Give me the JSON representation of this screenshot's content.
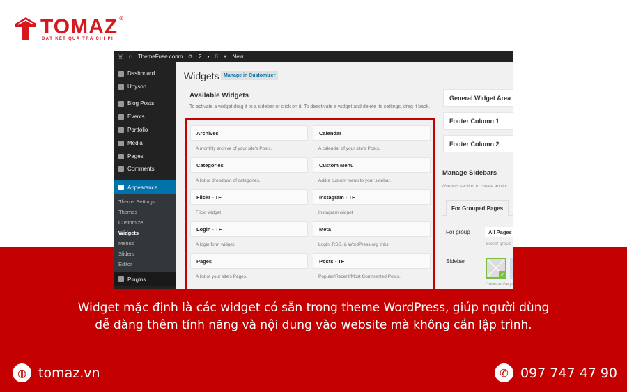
{
  "brand": {
    "name": "TOMAZ",
    "registered": "®",
    "tagline": "ĐẠT KẾT QUẢ TRẢ CHI PHÍ"
  },
  "colors": {
    "brand_red": "#c40000",
    "wp_accent": "#0073aa",
    "wp_dark": "#222222"
  },
  "wp": {
    "topbar": {
      "site": "ThemeFuse.conm",
      "updates": "2",
      "comments": "0",
      "new": "New"
    },
    "menu": [
      "Dashboard",
      "Unyson",
      "Blog Posts",
      "Events",
      "Portfolio",
      "Media",
      "Pages",
      "Comments"
    ],
    "appearance": "Appearance",
    "submenu": [
      "Theme Settings",
      "Themes",
      "Customize",
      "Widgets",
      "Menus",
      "Sliders",
      "Editor"
    ],
    "plugins": "Plugins",
    "title": "Widgets",
    "manage_customizer": "Manage in Customizer",
    "available_title": "Available Widgets",
    "available_desc": "To activate a widget drag it to a sidebar or click on it. To deactivate a widget and delete its settings, drag it back.",
    "widgets": [
      {
        "name": "Archives",
        "desc": "A monthly archive of your site's Posts."
      },
      {
        "name": "Calendar",
        "desc": "A calendar of your site's Posts."
      },
      {
        "name": "Categories",
        "desc": "A list or dropdown of categories."
      },
      {
        "name": "Custom Menu",
        "desc": "Add a custom menu to your sidebar."
      },
      {
        "name": "Flickr - TF",
        "desc": "Flickr widget"
      },
      {
        "name": "Instagram - TF",
        "desc": "Instagram widget"
      },
      {
        "name": "Login - TF",
        "desc": "A login form widget."
      },
      {
        "name": "Meta",
        "desc": "Login, RSS, & WordPress.org links."
      },
      {
        "name": "Pages",
        "desc": "A list of your site's Pages."
      },
      {
        "name": "Posts - TF",
        "desc": "Popular/Recent/Most Commented Posts."
      }
    ],
    "areas": [
      "General Widget Area",
      "Footer Column 1",
      "Footer Column 2"
    ],
    "manage_sidebars": "Manage Sidebars",
    "manage_desc": "Use this section to create and/or",
    "tab": "For Grouped Pages",
    "for_group_label": "For group",
    "for_group_value": "All Pages",
    "select_group": "Select group",
    "sidebar_label": "Sidebar",
    "choose": "Choose the p"
  },
  "caption": [
    "Widget mặc định là các widget có sẵn trong theme WordPress, giúp người dùng",
    "dễ dàng thêm tính năng và nội dung vào website mà không cần lập trình."
  ],
  "footer": {
    "website": "tomaz.vn",
    "phone": "097 747 47 90"
  }
}
